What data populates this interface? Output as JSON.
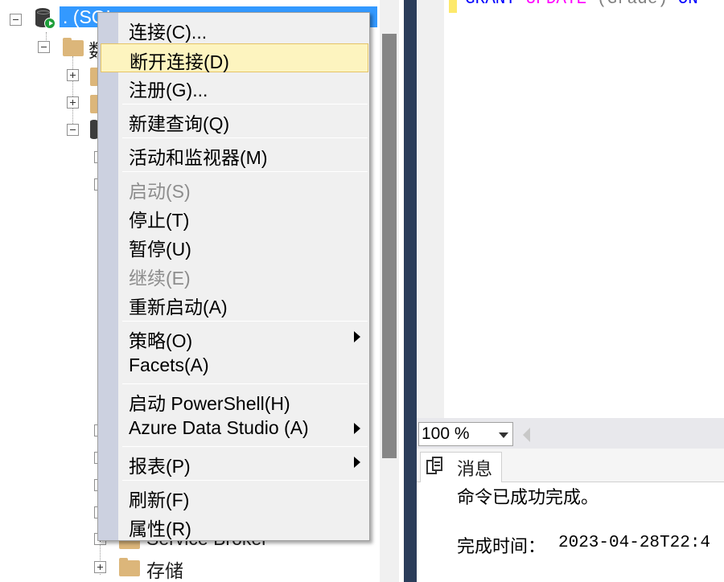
{
  "object_explorer": {
    "server_label": ". (SQL",
    "visible_labels": {
      "databases_partial": "数",
      "service_broker": "Service Broker",
      "storage": "存储"
    }
  },
  "context_menu": {
    "items": [
      {
        "label": "连接(C)...",
        "enabled": true
      },
      {
        "label": "断开连接(D)",
        "enabled": true,
        "hovered": true
      },
      {
        "label": "注册(G)...",
        "enabled": true
      },
      {
        "label": "新建查询(Q)",
        "enabled": true
      },
      {
        "label": "活动和监视器(M)",
        "enabled": true
      },
      {
        "label": "启动(S)",
        "enabled": false
      },
      {
        "label": "停止(T)",
        "enabled": true
      },
      {
        "label": "暂停(U)",
        "enabled": true
      },
      {
        "label": "继续(E)",
        "enabled": false
      },
      {
        "label": "重新启动(A)",
        "enabled": true
      },
      {
        "label": "策略(O)",
        "enabled": true,
        "submenu": true
      },
      {
        "label": "Facets(A)",
        "enabled": true
      },
      {
        "label": "启动 PowerShell(H)",
        "enabled": true
      },
      {
        "label": "Azure Data Studio (A)",
        "enabled": true,
        "submenu": true
      },
      {
        "label": "报表(P)",
        "enabled": true,
        "submenu": true
      },
      {
        "label": "刷新(F)",
        "enabled": true
      },
      {
        "label": "属性(R)",
        "enabled": true
      }
    ]
  },
  "editor": {
    "code": {
      "kw1": "GRANT",
      "kw2": "UPDATE",
      "paren": "(Grade)",
      "kw3": "ON"
    },
    "zoom": "100 %"
  },
  "results": {
    "tab_label": "消息",
    "message": "命令已成功完成。",
    "completion_label": "完成时间：",
    "completion_time": "2023-04-28T22:4"
  },
  "colors": {
    "selection": "#3399ff",
    "menu_hover": "#fdf4bf",
    "splitter": "#2b3d5a",
    "keyword_magenta": "#ff00ff"
  }
}
